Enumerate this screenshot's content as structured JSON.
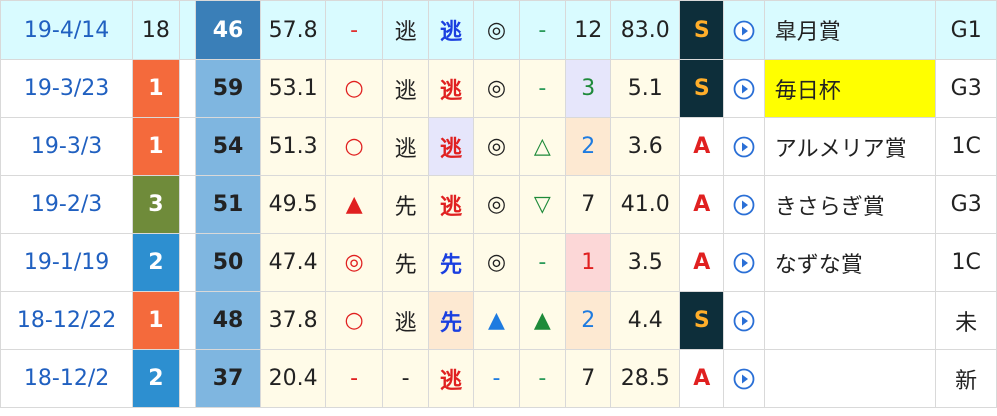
{
  "rows": [
    {
      "date": "19-4/14",
      "place": "18",
      "score": "46",
      "time": "57.8",
      "mark": "-",
      "style": "逃",
      "run": "逃",
      "eval1": "◎",
      "eval2": "-",
      "pop": "12",
      "odds": "83.0",
      "grade": "S",
      "race": "皐月賞",
      "cls": "G1"
    },
    {
      "date": "19-3/23",
      "place": "1",
      "score": "59",
      "time": "53.1",
      "mark": "○",
      "style": "逃",
      "run": "逃",
      "eval1": "◎",
      "eval2": "-",
      "pop": "3",
      "odds": "5.1",
      "grade": "S",
      "race": "毎日杯",
      "cls": "G3"
    },
    {
      "date": "19-3/3",
      "place": "1",
      "score": "54",
      "time": "51.3",
      "mark": "○",
      "style": "逃",
      "run": "逃",
      "eval1": "◎",
      "eval2": "△",
      "pop": "2",
      "odds": "3.6",
      "grade": "A",
      "race": "アルメリア賞",
      "cls": "1C"
    },
    {
      "date": "19-2/3",
      "place": "3",
      "score": "51",
      "time": "49.5",
      "mark": "▲",
      "style": "先",
      "run": "逃",
      "eval1": "◎",
      "eval2": "▽",
      "pop": "7",
      "odds": "41.0",
      "grade": "A",
      "race": "きさらぎ賞",
      "cls": "G3"
    },
    {
      "date": "19-1/19",
      "place": "2",
      "score": "50",
      "time": "47.4",
      "mark": "◎",
      "style": "先",
      "run": "先",
      "eval1": "◎",
      "eval2": "-",
      "pop": "1",
      "odds": "3.5",
      "grade": "A",
      "race": "なずな賞",
      "cls": "1C"
    },
    {
      "date": "18-12/22",
      "place": "1",
      "score": "48",
      "time": "37.8",
      "mark": "○",
      "style": "逃",
      "run": "先",
      "eval1": "▲",
      "eval2": "▲",
      "pop": "2",
      "odds": "4.4",
      "grade": "S",
      "race": "",
      "cls": "未"
    },
    {
      "date": "18-12/2",
      "place": "2",
      "score": "37",
      "time": "20.4",
      "mark": "-",
      "style": "-",
      "run": "逃",
      "eval1": "-",
      "eval2": "-",
      "pop": "7",
      "odds": "28.5",
      "grade": "A",
      "race": "",
      "cls": "新"
    }
  ],
  "icons": {
    "play": "play-circle-icon"
  },
  "colors": {
    "place1": "#f46a3c",
    "place2": "#2d8fd0",
    "place3": "#6f8b3a",
    "gradeS_bg": "#0d2e3a",
    "gradeS_text": "#ffae2a",
    "gradeA_text": "#e02020",
    "highlight": "#ffff00",
    "selected_row": "#d9fbff"
  }
}
